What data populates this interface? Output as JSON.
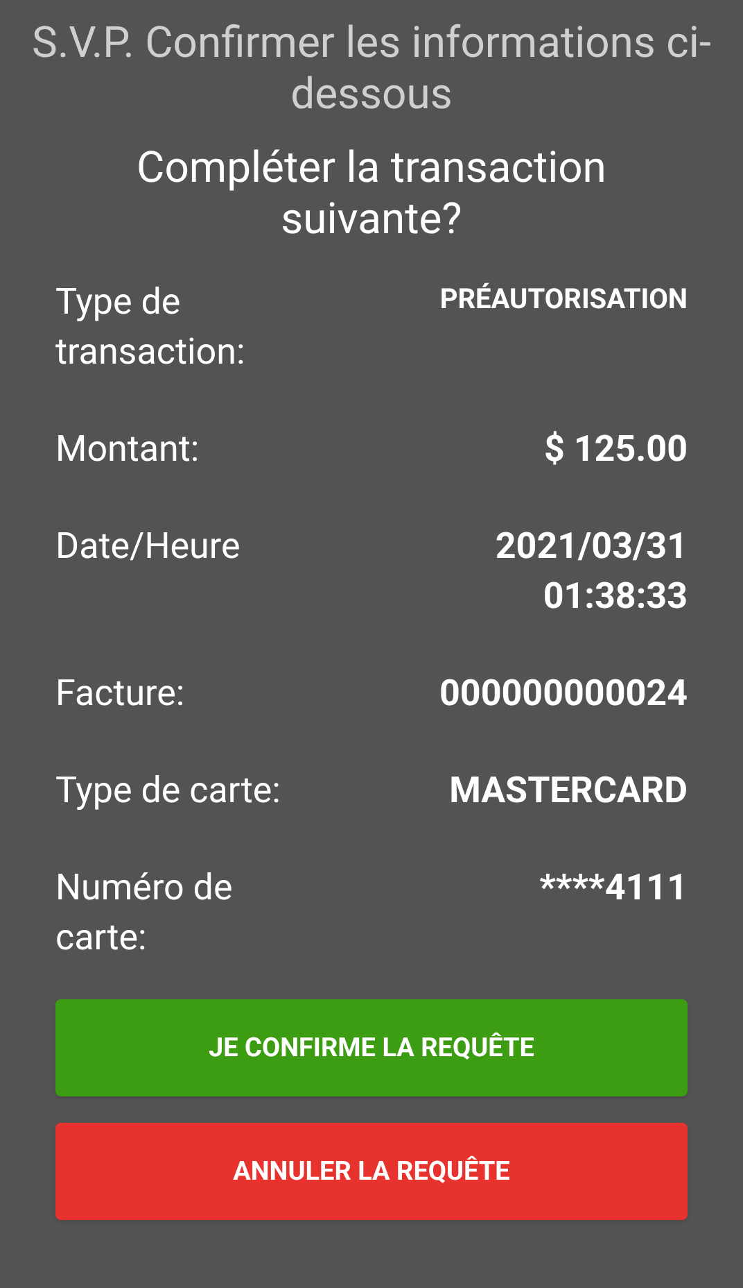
{
  "header": {
    "title": "S.V.P. Confirmer les informations ci-dessous",
    "question": "Compléter la transaction suivante?"
  },
  "details": [
    {
      "label": "Type de transaction:",
      "value": "PRÉAUTORISATION",
      "kind": "small"
    },
    {
      "label": "Montant:",
      "value": "$ 125.00",
      "kind": "normal"
    },
    {
      "label": "Date/Heure",
      "value": "2021/03/31 01:38:33",
      "kind": "normal"
    },
    {
      "label": "Facture:",
      "value": "000000000024",
      "kind": "normal"
    },
    {
      "label": "Type de carte:",
      "value": "MASTERCARD",
      "kind": "normal"
    },
    {
      "label": "Numéro de carte:",
      "value": "****4111",
      "kind": "normal"
    }
  ],
  "buttons": [
    {
      "label": "JE CONFIRME LA REQUÊTE",
      "kind": "confirm"
    },
    {
      "label": "ANNULER LA REQUÊTE",
      "kind": "cancel"
    }
  ]
}
